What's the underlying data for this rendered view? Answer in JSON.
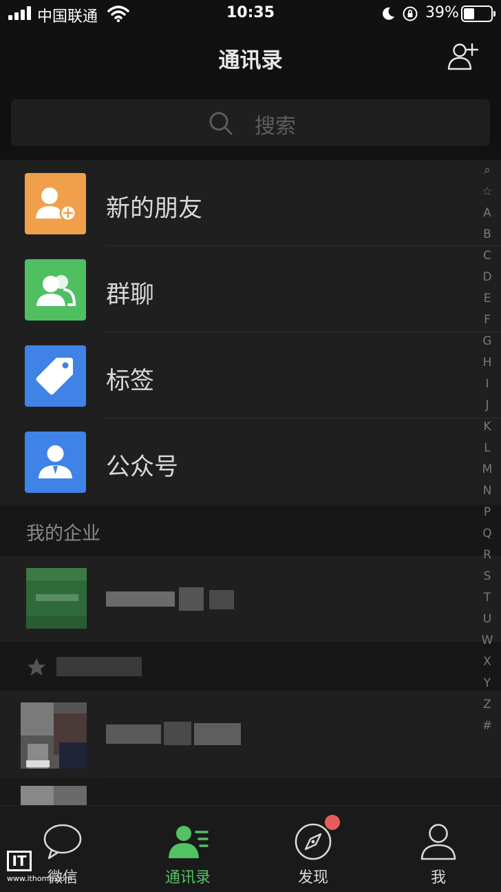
{
  "status_bar": {
    "carrier": "中国联通",
    "time": "10:35",
    "battery_percent": "39%",
    "battery_level": 0.39,
    "icons": [
      "signal-icon",
      "wifi-icon",
      "moon-icon",
      "rotation-lock-icon",
      "battery-icon"
    ]
  },
  "nav": {
    "title": "通讯录",
    "add_contact_icon": "add-contact-icon"
  },
  "search": {
    "placeholder": "搜索",
    "icon": "search-icon"
  },
  "menu": {
    "items": [
      {
        "label": "新的朋友",
        "icon": "new-friends-icon",
        "color": "#f0a04b"
      },
      {
        "label": "群聊",
        "icon": "group-chat-icon",
        "color": "#4fbf62"
      },
      {
        "label": "标签",
        "icon": "tag-icon",
        "color": "#3f83e6"
      },
      {
        "label": "公众号",
        "icon": "official-account-icon",
        "color": "#3f83e6"
      }
    ]
  },
  "sections": {
    "enterprise": "我的企业",
    "starred_icon": "star-icon"
  },
  "index_letters": [
    "⌕",
    "☆",
    "A",
    "B",
    "C",
    "D",
    "E",
    "F",
    "G",
    "H",
    "I",
    "J",
    "K",
    "L",
    "M",
    "N",
    "P",
    "Q",
    "R",
    "S",
    "T",
    "U",
    "W",
    "X",
    "Y",
    "Z",
    "#"
  ],
  "tabs": [
    {
      "label": "微信",
      "icon": "chat-bubble-icon",
      "active": false
    },
    {
      "label": "通讯录",
      "icon": "contacts-icon",
      "active": true
    },
    {
      "label": "发现",
      "icon": "compass-icon",
      "active": false,
      "badge": true
    },
    {
      "label": "我",
      "icon": "profile-icon",
      "active": false
    }
  ],
  "watermark": {
    "logo": "IT",
    "url": "www.ithome.com"
  },
  "colors": {
    "background": "#191919",
    "surface": "#1f1f1f",
    "accent": "#52c264",
    "badge": "#e85c5c"
  }
}
